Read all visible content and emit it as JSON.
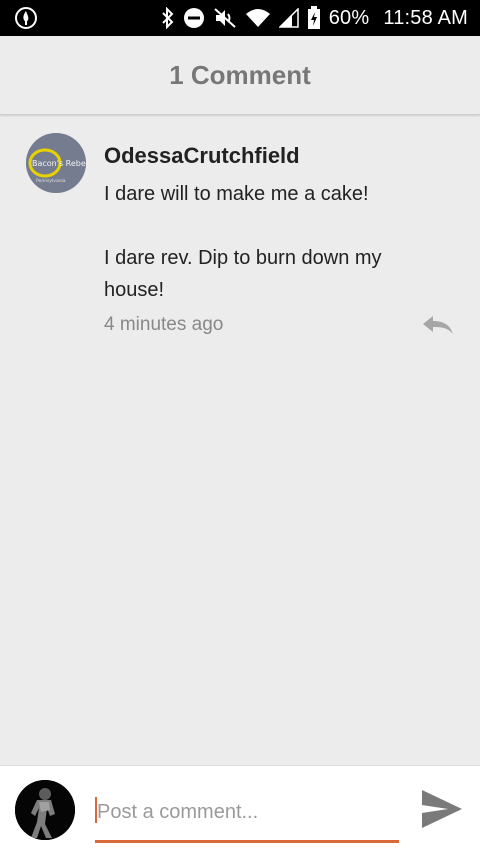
{
  "status_bar": {
    "battery": "60%",
    "time": "11:58 AM",
    "icons": [
      "app-notification-icon",
      "bluetooth-icon",
      "do-not-disturb-icon",
      "mute-icon",
      "wifi-icon",
      "signal-icon",
      "battery-charging-icon"
    ]
  },
  "header": {
    "title": "1 Comment"
  },
  "comments": [
    {
      "author": "OdessaCrutchfield",
      "text": "I dare will to make me a cake!\n\nI dare rev. Dip to burn down my house!",
      "timestamp": "4 minutes ago",
      "avatar_text": "Bacon's Rebe",
      "avatar_subtext": "Pennsylvania"
    }
  ],
  "composer": {
    "placeholder": "Post a comment..."
  },
  "colors": {
    "accent": "#d9683a",
    "background": "#ececec",
    "header_text": "#777777"
  }
}
